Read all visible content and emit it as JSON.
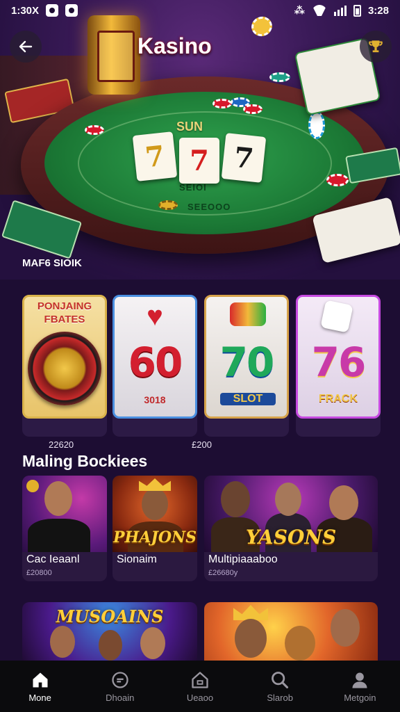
{
  "status_bar": {
    "time_left": "1:30X",
    "time_right": "3:28"
  },
  "hero": {
    "title": "Kasino",
    "caption": "MAF6 SIOIK",
    "felt_title": "SUN",
    "felt_sub_1": "SEIOI",
    "felt_sub_2": "SEEOOO",
    "cards": [
      "7",
      "7",
      "7"
    ]
  },
  "featured": [
    {
      "header": "PONJAING FBATES",
      "number": "",
      "label": "",
      "price": "22620",
      "border": "#d9b24a",
      "bg": "#f4d98a"
    },
    {
      "header": "",
      "number": "60",
      "label": "3018",
      "price": "",
      "border": "#4a8fe0",
      "bg": "#f1eef0"
    },
    {
      "header": "",
      "number": "70",
      "label": "SLOT",
      "price": "£200",
      "border": "#d6a24a",
      "bg": "#f1eef0"
    },
    {
      "header": "",
      "number": "76",
      "label": "FRACK",
      "price": "",
      "border": "#c64ae0",
      "bg": "#f1e6f6"
    }
  ],
  "section": {
    "title": "Maling Bockiees"
  },
  "games": [
    {
      "name": "Cac Ieaanl",
      "sub": "£20800",
      "art_title": ""
    },
    {
      "name": "Sionaim",
      "sub": "",
      "art_title": "PHAJONS"
    },
    {
      "name": "Multipiaaaboo",
      "sub": "£26680y",
      "art_title": "YASONS"
    }
  ],
  "bottom_cards": [
    {
      "art_title": "MUSOAINS"
    },
    {
      "art_title": ""
    }
  ],
  "nav": [
    {
      "label": "Mone",
      "icon": "home-icon",
      "active": true
    },
    {
      "label": "Dhoain",
      "icon": "chat-bubble-icon",
      "active": false
    },
    {
      "label": "Ueaoo",
      "icon": "house-outline-icon",
      "active": false
    },
    {
      "label": "Slarob",
      "icon": "search-icon",
      "active": false
    },
    {
      "label": "Metgoin",
      "icon": "profile-icon",
      "active": false
    }
  ],
  "colors": {
    "background": "#1d0d33",
    "accent": "#ffcf3a",
    "felt": "#1c7a36",
    "nav_bg": "#0b0b0d"
  }
}
